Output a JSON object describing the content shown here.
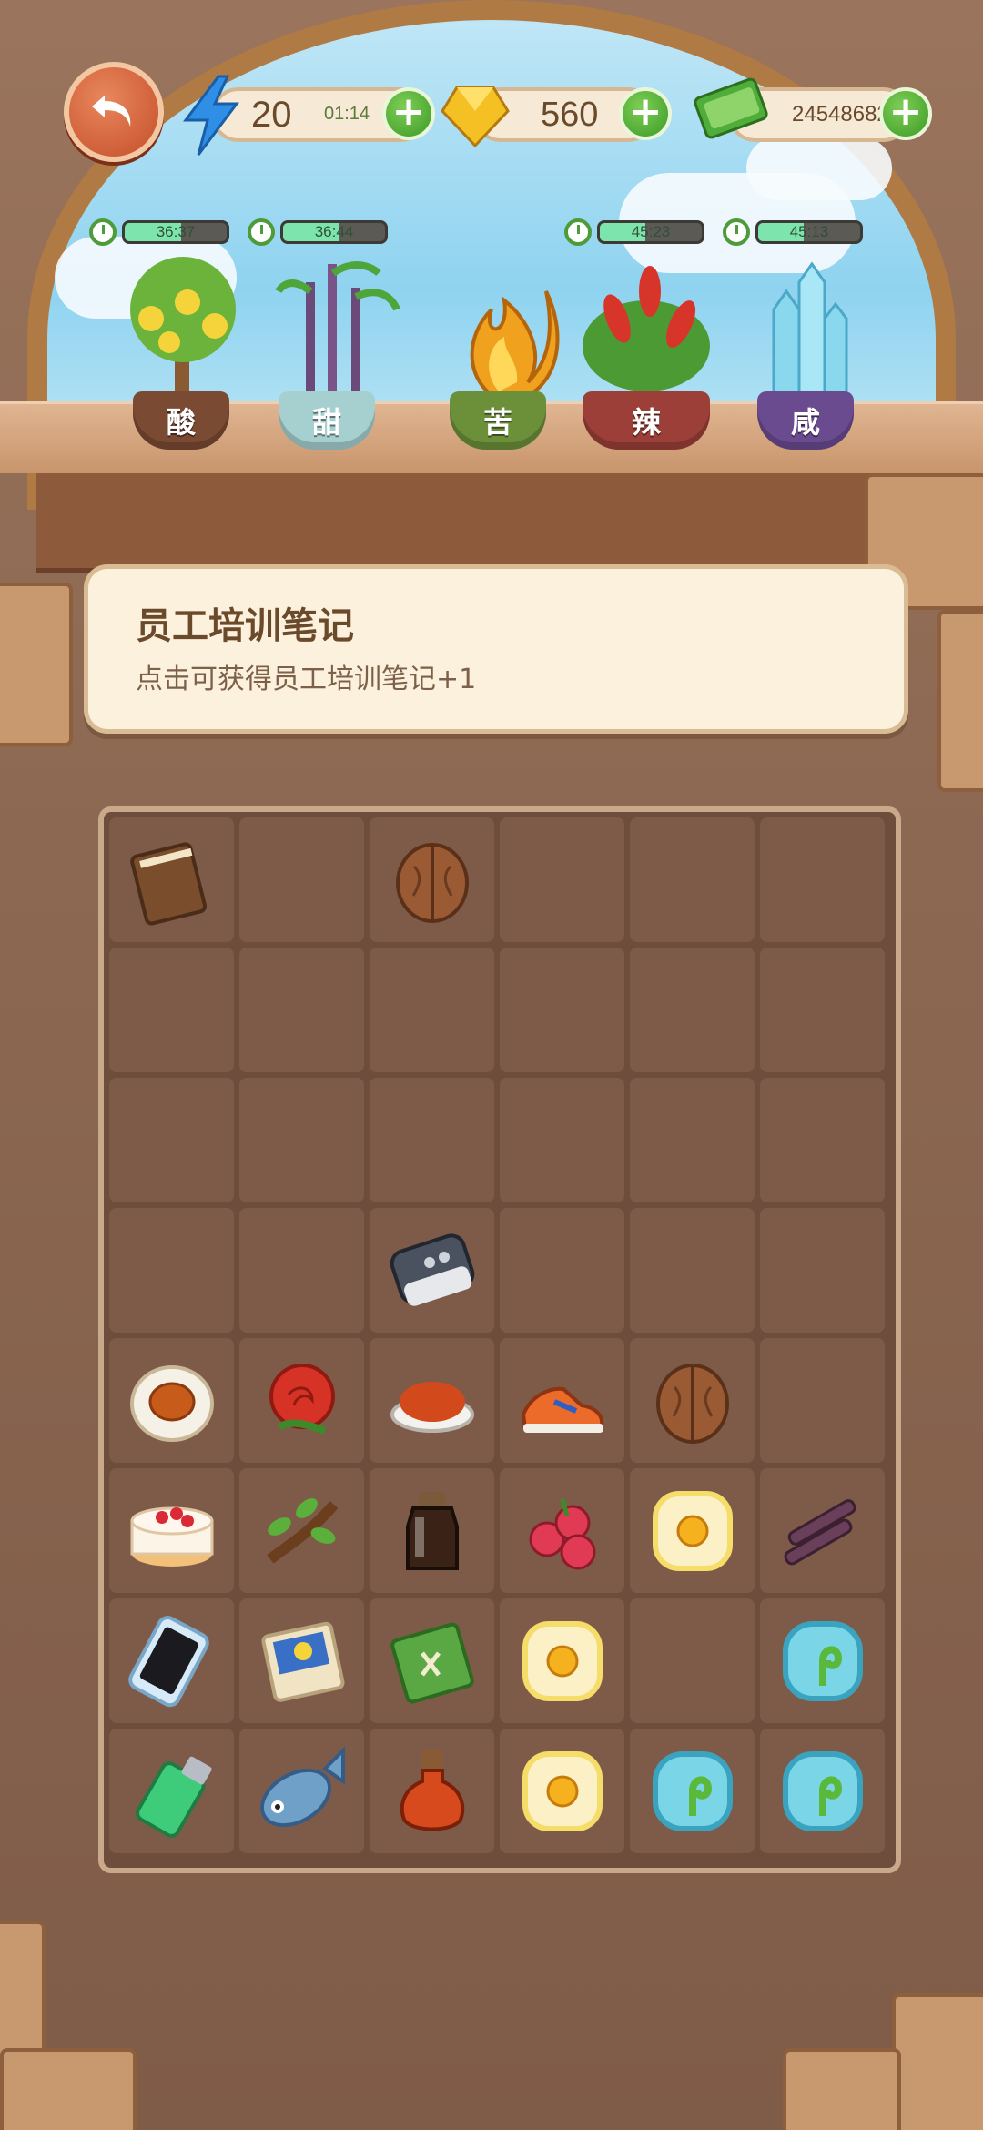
{
  "hud": {
    "energy": {
      "value": "20",
      "timer": "01:14",
      "icon": "lightning-bolt-icon"
    },
    "gems": {
      "value": "560",
      "icon": "gem-icon"
    },
    "cash": {
      "value": "24548682",
      "icon": "cash-stack-icon"
    }
  },
  "plants": [
    {
      "label": "酸",
      "timer": "36:37",
      "progress": 0.55,
      "plant": "lemon-tree",
      "pot_color": "#7a4a33"
    },
    {
      "label": "甜",
      "timer": "36:44",
      "progress": 0.55,
      "plant": "sugarcane",
      "pot_color": "#9fc8c9"
    },
    {
      "label": "苦",
      "timer": null,
      "progress": null,
      "plant": "golden-flame-tree",
      "pot_color": "#6c8f3a"
    },
    {
      "label": "辣",
      "timer": "45:23",
      "progress": 0.45,
      "plant": "chili-plant",
      "pot_color": "#9b3f38"
    },
    {
      "label": "咸",
      "timer": "45:13",
      "progress": 0.45,
      "plant": "salt-crystal",
      "pot_color": "#6a4b8f"
    }
  ],
  "info": {
    "title": "员工培训笔记",
    "description": "点击可获得员工培训笔记+1"
  },
  "board": {
    "rows": [
      [
        "notebook",
        "",
        "walnut",
        "",
        "",
        ""
      ],
      [
        "",
        "",
        "",
        "",
        "",
        ""
      ],
      [
        "",
        "",
        "",
        "",
        "",
        ""
      ],
      [
        "",
        "",
        "car-key",
        "",
        "",
        ""
      ],
      [
        "salted-egg",
        "rose",
        "chili-powder",
        "sneaker",
        "walnut",
        ""
      ],
      [
        "cake",
        "tamarind",
        "soy-sauce-bottle",
        "lychee",
        "fried-egg",
        "sugarcane"
      ],
      [
        "smartphone",
        "trading-card",
        "green-book",
        "fried-egg",
        "",
        "sprout-bubble"
      ],
      [
        "lighter",
        "fish",
        "sauce-flask",
        "fried-egg",
        "sprout-bubble",
        "sprout-bubble"
      ]
    ]
  }
}
